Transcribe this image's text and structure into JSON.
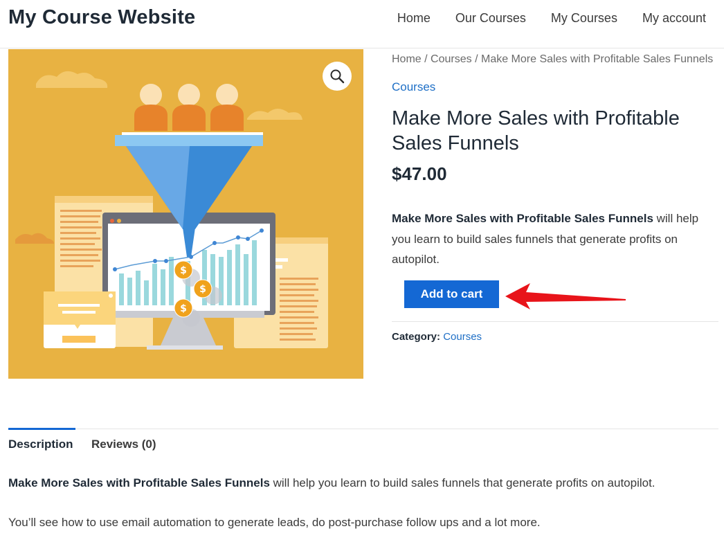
{
  "header": {
    "site_title": "My Course Website",
    "nav": [
      "Home",
      "Our Courses",
      "My Courses",
      "My account"
    ]
  },
  "breadcrumb": {
    "items": [
      "Home",
      "Courses",
      "Make More Sales with Profitable Sales Funnels"
    ],
    "separator": "/"
  },
  "product": {
    "category_link": "Courses",
    "title": "Make More Sales with Profitable Sales Funnels",
    "price": "$47.00",
    "short_description": {
      "bold": "Make More Sales with Profitable Sales Funnels",
      "rest": " will help you learn to build sales funnels that generate profits on autopilot."
    },
    "add_to_cart_label": "Add to cart",
    "meta": {
      "label": "Category:",
      "value": "Courses"
    },
    "image": {
      "background_color": "#e8b242",
      "zoom_icon": "magnifier-icon"
    }
  },
  "tabs": {
    "items": [
      "Description",
      "Reviews (0)"
    ],
    "active_index": 0
  },
  "description": {
    "p1_bold": "Make More Sales with Profitable Sales Funnels",
    "p1_rest": " will help you learn to build sales funnels that generate profits on autopilot.",
    "p2": "You’ll see how to use email automation to generate leads, do post-purchase follow ups and a lot more."
  },
  "colors": {
    "accent": "#1468d4",
    "link": "#1e6fc6",
    "arrow": "#e8141a"
  }
}
